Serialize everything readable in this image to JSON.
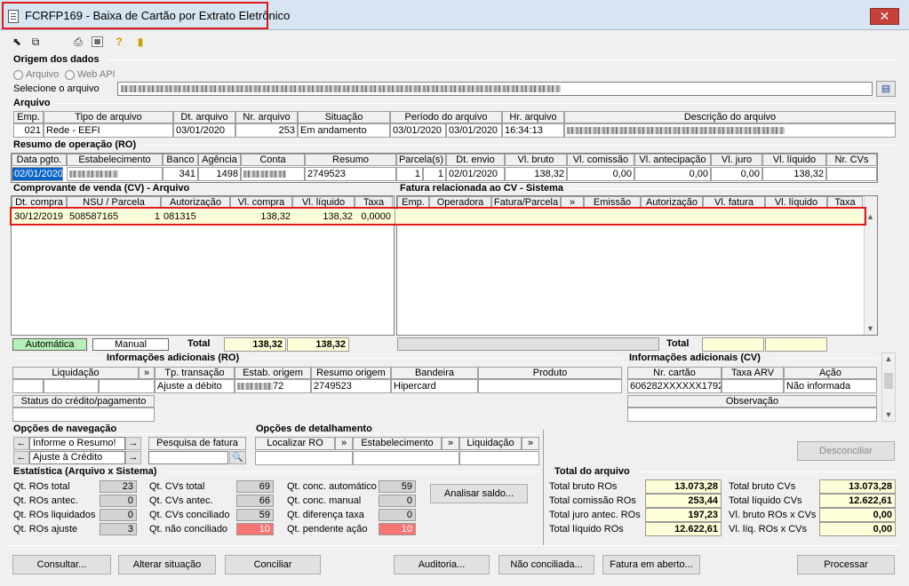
{
  "window": {
    "title": "FCRFP169 - Baixa de Cartão por Extrato Eletrônico",
    "close_symbol": "✕"
  },
  "toolbar": {
    "icons": [
      "import-icon",
      "export-icon",
      "print-icon",
      "calculator-icon",
      "help-icon",
      "exit-icon"
    ]
  },
  "origem": {
    "title": "Origem dos dados",
    "radio_arquivo": "Arquivo",
    "radio_webapi": "Web API",
    "select_label": "Selecione o arquivo"
  },
  "arquivo": {
    "title": "Arquivo",
    "headers": [
      "Emp.",
      "Tipo de arquivo",
      "Dt. arquivo",
      "Nr. arquivo",
      "Situação",
      "Período do arquivo",
      "Hr. arquivo",
      "Descrição do arquivo"
    ],
    "row": {
      "emp": "021",
      "tipo": "Rede - EEFI",
      "dt": "03/01/2020",
      "nr": "253",
      "situacao": "Em andamento",
      "periodo_ini": "03/01/2020",
      "periodo_fim": "03/01/2020",
      "hora": "16:34:13"
    }
  },
  "ro": {
    "title": "Resumo de operação (RO)",
    "headers": [
      "Data pgto.",
      "Estabelecimento",
      "Banco",
      "Agência",
      "Conta",
      "Resumo",
      "Parcela(s)",
      "Dt. envio",
      "Vl. bruto",
      "Vl. comissão",
      "Vl. antecipação",
      "Vl. juro",
      "Vl. líquido",
      "Nr. CVs"
    ],
    "row": {
      "data": "02/01/2020",
      "banco": "341",
      "agencia": "1498",
      "resumo": "2749523",
      "parcela_a": "1",
      "parcela_b": "1",
      "dt_envio": "02/01/2020",
      "bruto": "138,32",
      "comissao": "0,00",
      "antecipacao": "0,00",
      "juro": "0,00",
      "liquido": "138,32"
    }
  },
  "cv": {
    "title": "Comprovante de venda (CV) - Arquivo",
    "headers": [
      "Dt. compra",
      "NSU / Parcela",
      "Autorização",
      "Vl. compra",
      "Vl. líquido",
      "Taxa"
    ],
    "row": {
      "dt": "30/12/2019",
      "nsu": "508587165",
      "parcela": "1",
      "autorizacao": "081315",
      "compra": "138,32",
      "liquido": "138,32",
      "taxa": "0,0000"
    },
    "btn_automatica": "Automática",
    "btn_manual": "Manual",
    "total_label": "Total",
    "total_compra": "138,32",
    "total_liquido": "138,32"
  },
  "fatura": {
    "title": "Fatura relacionada ao CV - Sistema",
    "headers": [
      "Emp.",
      "Operadora",
      "Fatura/Parcela",
      "»",
      "Emissão",
      "Autorização",
      "Vl. fatura",
      "Vl. líquido",
      "Taxa"
    ],
    "total_label": "Total"
  },
  "info_ro": {
    "title": "Informações adicionais (RO)",
    "headers": [
      "Liquidação",
      "»",
      "Tp. transação",
      "Estab. origem",
      "Resumo origem",
      "Bandeira",
      "Produto"
    ],
    "row": {
      "tp": "Ajuste a débito",
      "estab_suffix": "72",
      "resumo": "2749523",
      "bandeira": "Hipercard"
    },
    "status_label": "Status do crédito/pagamento"
  },
  "info_cv": {
    "title": "Informações adicionais (CV)",
    "headers": [
      "Nr. cartão",
      "Taxa ARV",
      "Ação"
    ],
    "row": {
      "cartao": "606282XXXXXX1792",
      "acao": "Não informada"
    },
    "obs_label": "Observação"
  },
  "nav": {
    "title": "Opções de navegação",
    "item1": "Informe o Resumo!",
    "item2": "Ajuste à Crédito",
    "left": "←",
    "right": "→",
    "search_label": "Pesquisa de fatura"
  },
  "detail": {
    "title": "Opções de detalhamento",
    "btn1": "Localizar RO",
    "btn2": "Estabelecimento",
    "btn3": "Liquidação",
    "arrow": "»"
  },
  "desconciliar": "Desconciliar",
  "stats": {
    "title": "Estatística (Arquivo x Sistema)",
    "c1": [
      {
        "label": "Qt. ROs total",
        "value": "23"
      },
      {
        "label": "Qt. ROs antec.",
        "value": "0"
      },
      {
        "label": "Qt. ROs liquidados",
        "value": "0"
      },
      {
        "label": "Qt. ROs ajuste",
        "value": "3"
      }
    ],
    "c2": [
      {
        "label": "Qt. CVs total",
        "value": "69"
      },
      {
        "label": "Qt. CVs antec.",
        "value": "66"
      },
      {
        "label": "Qt. CVs conciliado",
        "value": "59"
      },
      {
        "label": "Qt. não conciliado",
        "value": "10"
      }
    ],
    "c3": [
      {
        "label": "Qt. conc. automático",
        "value": "59"
      },
      {
        "label": "Qt. conc. manual",
        "value": "0"
      },
      {
        "label": "Qt. diferença taxa",
        "value": "0"
      },
      {
        "label": "Qt. pendente ação",
        "value": "10"
      }
    ],
    "analisar": "Analisar saldo..."
  },
  "total_arquivo": {
    "title": "Total do arquivo",
    "left": [
      {
        "label": "Total bruto ROs",
        "value": "13.073,28"
      },
      {
        "label": "Total comissão ROs",
        "value": "253,44"
      },
      {
        "label": "Total juro antec. ROs",
        "value": "197,23"
      },
      {
        "label": "Total líquido ROs",
        "value": "12.622,61"
      }
    ],
    "right": [
      {
        "label": "Total bruto CVs",
        "value": "13.073,28"
      },
      {
        "label": "Total líquido CVs",
        "value": "12.622,61"
      },
      {
        "label": "Vl. bruto ROs x CVs",
        "value": "0,00"
      },
      {
        "label": "Vl. líq. ROs x CVs",
        "value": "0,00"
      }
    ]
  },
  "buttons": {
    "consultar": "Consultar...",
    "alterar": "Alterar situação",
    "conciliar": "Conciliar",
    "auditoria": "Auditoria...",
    "nao_conciliada": "Não conciliada...",
    "fatura_aberto": "Fatura em aberto...",
    "processar": "Processar"
  },
  "colors": {
    "highlight": "#e01b1b",
    "yellow": "#fefed8",
    "green": "#b6f0b6",
    "red": "#f77474"
  }
}
